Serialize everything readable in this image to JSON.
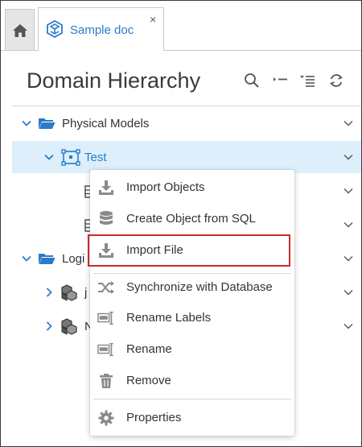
{
  "tabs": {
    "home_icon": "home-icon",
    "doc_label": "Sample doc",
    "close_glyph": "×"
  },
  "header": {
    "title": "Domain Hierarchy",
    "tools": [
      "search-icon",
      "collapse-icon",
      "expand-list-icon",
      "refresh-icon"
    ]
  },
  "tree": {
    "physical_models": "Physical Models",
    "test": "Test",
    "logical_partial": "Logi",
    "child_j_partial": "j",
    "child_n_partial": "N"
  },
  "context_menu": {
    "items": [
      {
        "label": "Import Objects",
        "icon": "import-icon"
      },
      {
        "label": "Create Object from SQL",
        "icon": "database-icon"
      },
      {
        "label": "Import File",
        "icon": "import-file-icon",
        "highlighted": true
      },
      {
        "label": "Synchronize with Database",
        "icon": "shuffle-icon"
      },
      {
        "label": "Rename Labels",
        "icon": "rename-labels-icon"
      },
      {
        "label": "Rename",
        "icon": "rename-icon"
      },
      {
        "label": "Remove",
        "icon": "trash-icon"
      },
      {
        "label": "Properties",
        "icon": "gear-icon"
      }
    ]
  },
  "colors": {
    "accent": "#2c7ac9",
    "selection": "#dceffa",
    "highlight_border": "#cc2a2a",
    "icon_gray": "#8a8a8a"
  }
}
